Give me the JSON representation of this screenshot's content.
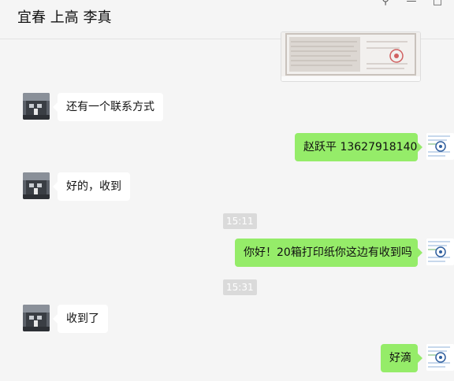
{
  "window": {
    "title": "宜春 上高 李真",
    "pin_glyph": "⚲",
    "minimize_glyph": "—",
    "maximize_glyph": "□"
  },
  "messages": [
    {
      "type": "image",
      "direction": "out",
      "description": "certificate-image"
    },
    {
      "type": "text",
      "direction": "in",
      "text": "还有一个联系方式"
    },
    {
      "type": "text",
      "direction": "out",
      "text": "赵跃平 13627918140"
    },
    {
      "type": "text",
      "direction": "in",
      "text": "好的，收到"
    },
    {
      "type": "time",
      "text": "15:11"
    },
    {
      "type": "text",
      "direction": "out",
      "text": "你好！20箱打印纸你这边有收到吗"
    },
    {
      "type": "time",
      "text": "15:31"
    },
    {
      "type": "text",
      "direction": "in",
      "text": "收到了"
    },
    {
      "type": "text",
      "direction": "out",
      "text": "好滴"
    }
  ],
  "colors": {
    "background": "#f5f5f5",
    "bubble_in": "#ffffff",
    "bubble_out": "#95ec69",
    "timestamp_bg": "#dadada"
  }
}
